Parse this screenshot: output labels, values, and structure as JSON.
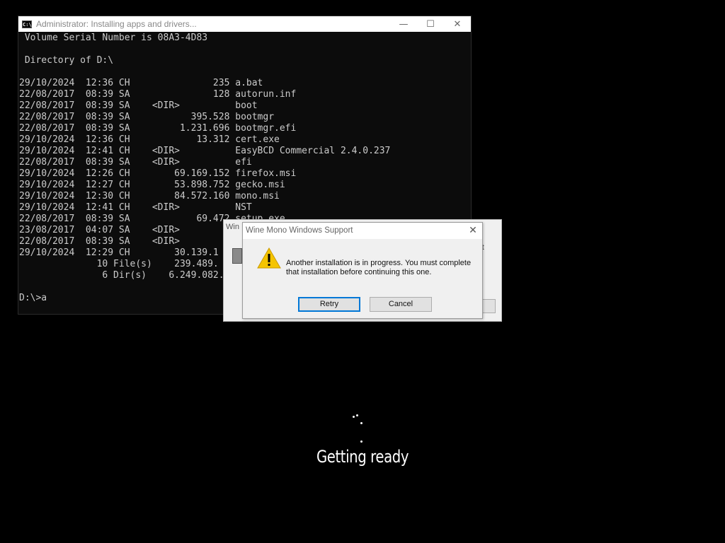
{
  "console": {
    "title": "Administrator:  Installing apps and drivers...",
    "icon": "cmd-icon",
    "lines": [
      " Volume Serial Number is 08A3-4D83",
      "",
      " Directory of D:\\",
      "",
      "29/10/2024  12:36 CH               235 a.bat",
      "22/08/2017  08:39 SA               128 autorun.inf",
      "22/08/2017  08:39 SA    <DIR>          boot",
      "22/08/2017  08:39 SA           395.528 bootmgr",
      "22/08/2017  08:39 SA         1.231.696 bootmgr.efi",
      "29/10/2024  12:36 CH            13.312 cert.exe",
      "29/10/2024  12:41 CH    <DIR>          EasyBCD Commercial 2.4.0.237",
      "22/08/2017  08:39 SA    <DIR>          efi",
      "29/10/2024  12:26 CH        69.169.152 firefox.msi",
      "29/10/2024  12:27 CH        53.898.752 gecko.msi",
      "29/10/2024  12:30 CH        84.572.160 mono.msi",
      "29/10/2024  12:41 CH    <DIR>          NST",
      "22/08/2017  08:39 SA            69.472 setup.exe",
      "23/08/2017  04:07 SA    <DIR>",
      "22/08/2017  08:39 SA    <DIR>",
      "29/10/2024  12:29 CH        30.139.1",
      "              10 File(s)    239.489.",
      "               6 Dir(s)    6.249.082.",
      "",
      "D:\\>a"
    ],
    "controls": {
      "minimize": "—",
      "maximize": "☐",
      "close": "✕"
    }
  },
  "back_dialog": {
    "title": "Win",
    "partial_text": "rt"
  },
  "dialog": {
    "title": "Wine Mono Windows Support",
    "close": "✕",
    "icon": "warning-icon",
    "message": "Another installation is in progress. You must complete that installation before continuing this one.",
    "buttons": {
      "retry": "Retry",
      "cancel": "Cancel"
    },
    "accent": "#0078d7"
  },
  "status": {
    "text": "Getting ready",
    "spinner_icon": "loading-spinner-icon"
  }
}
